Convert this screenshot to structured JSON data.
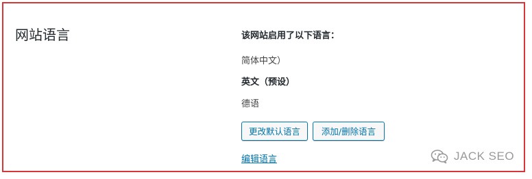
{
  "section": {
    "title": "网站语言"
  },
  "languages": {
    "intro": "该网站启用了以下语言：",
    "items": [
      {
        "label": "简体中文）",
        "is_default": false
      },
      {
        "label": "英文（预设）",
        "is_default": true
      },
      {
        "label": "德语",
        "is_default": false
      }
    ]
  },
  "actions": {
    "change_default_label": "更改默认语言",
    "add_remove_label": "添加/删除语言",
    "edit_link_label": "编辑语言"
  },
  "watermark": {
    "text": "JACK SEO",
    "icon": "wechat-icon"
  },
  "colors": {
    "frame_border": "#d63638",
    "link": "#0073aa",
    "text": "#23282d"
  }
}
